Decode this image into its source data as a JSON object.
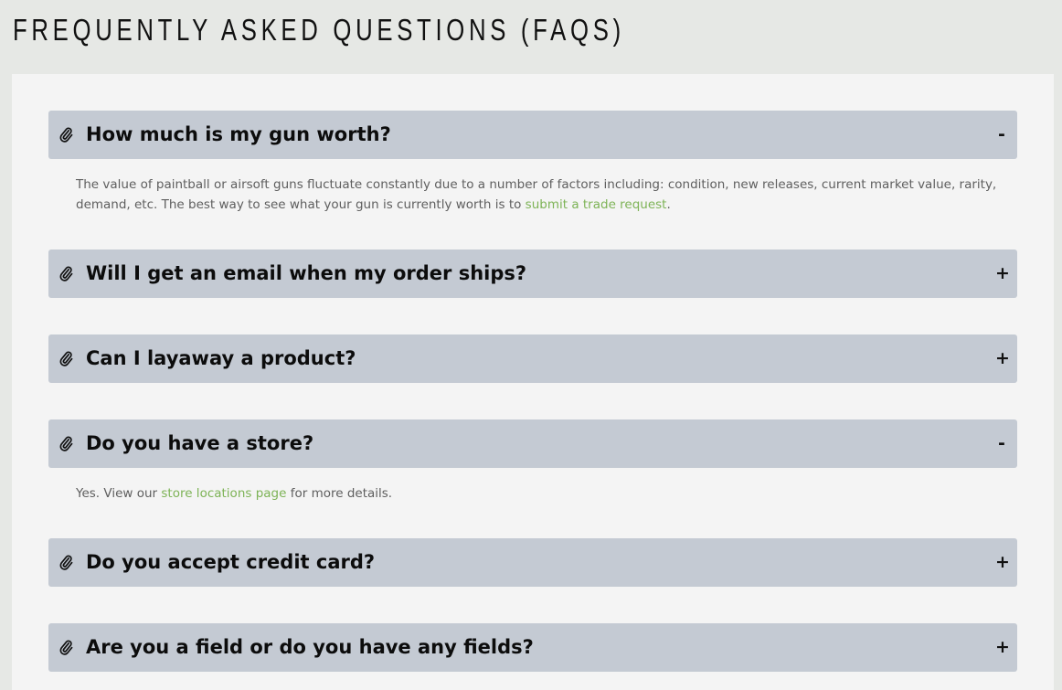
{
  "page": {
    "title": "FREQUENTLY ASKED QUESTIONS (FAQS)"
  },
  "theme": {
    "header_bg": "#c4cad3",
    "link_color": "#7db356",
    "answer_color": "#5e5e5e",
    "panel_bg": "#f4f4f4",
    "page_bg": "#e6e8e5"
  },
  "faqs": [
    {
      "question": "How much is my gun worth?",
      "icon": "paperclip-icon",
      "toggle": "-",
      "expanded": true,
      "answer_before": "The value of paintball or airsoft guns fluctuate constantly due to a number of factors including: condition, new releases, current market value, rarity, demand, etc. The best way to see what your gun is currently worth is to ",
      "answer_link": "submit a trade request",
      "answer_after": "."
    },
    {
      "question": "Will I get an email when my order ships?",
      "icon": "paperclip-icon",
      "toggle": "+",
      "expanded": false
    },
    {
      "question": "Can I layaway a product?",
      "icon": "paperclip-icon",
      "toggle": "+",
      "expanded": false
    },
    {
      "question": "Do you have a store?",
      "icon": "paperclip-icon",
      "toggle": "-",
      "expanded": true,
      "answer_before": "Yes. View our ",
      "answer_link": "store locations page",
      "answer_after": " for more details."
    },
    {
      "question": "Do you accept credit card?",
      "icon": "paperclip-icon",
      "toggle": "+",
      "expanded": false
    },
    {
      "question": "Are you a field or do you have any fields?",
      "icon": "paperclip-icon",
      "toggle": "+",
      "expanded": false
    }
  ]
}
